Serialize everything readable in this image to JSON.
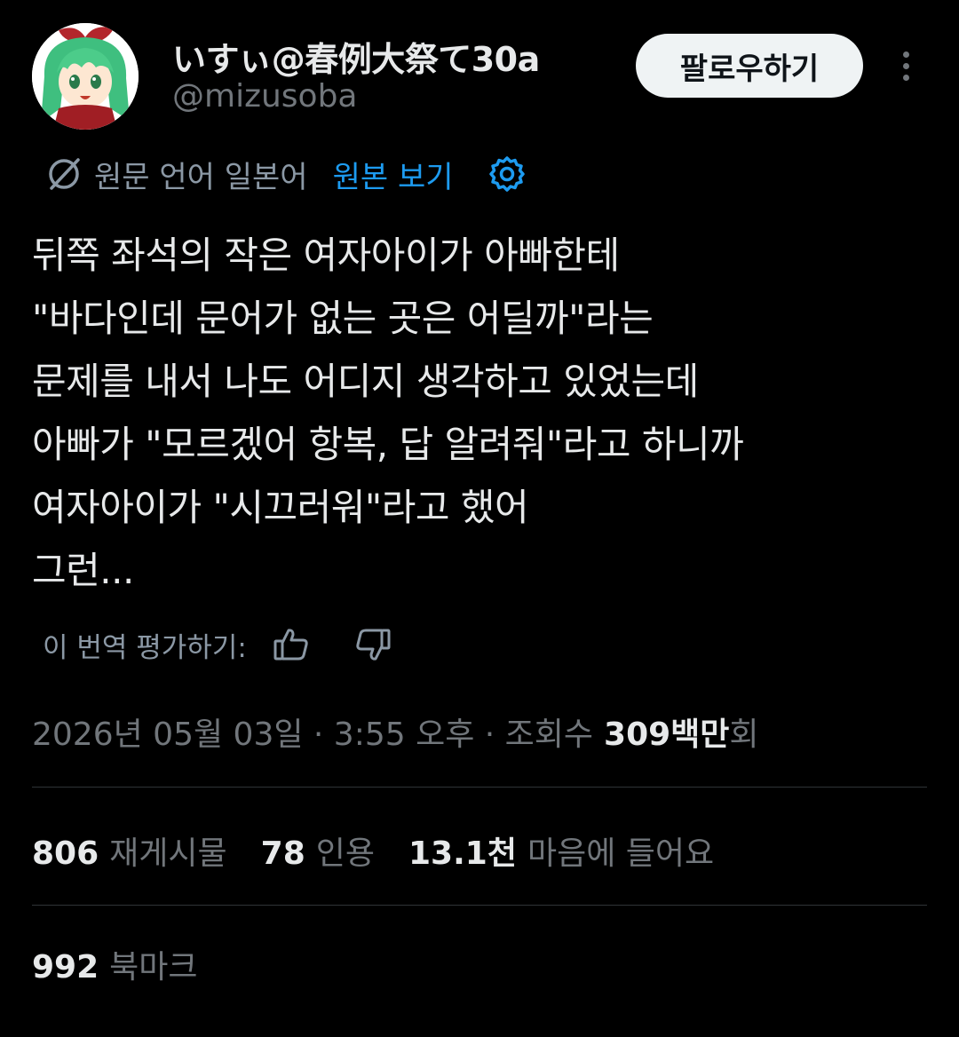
{
  "author": {
    "display_name": "いすぃ@春例大祭て30a",
    "handle": "@mizusoba",
    "avatar_icon": "avatar-green-hair-character"
  },
  "header": {
    "follow_label": "팔로우하기",
    "more_icon": "more-vertical-icon"
  },
  "translation": {
    "icon": "translate-icon",
    "source_language_label": "원문 언어 일본어",
    "view_original_label": "원본 보기",
    "settings_icon": "gear-icon"
  },
  "tweet": {
    "lines": [
      "뒤쪽 좌석의 작은 여자아이가 아빠한테",
      "\"바다인데 문어가 없는 곳은 어딜까\"라는",
      "문제를 내서 나도 어디지 생각하고 있었는데",
      "아빠가 \"모르겠어 항복, 답 알려줘\"라고 하니까",
      "여자아이가 \"시끄러워\"라고 했어",
      "그런..."
    ]
  },
  "rating": {
    "label": "이 번역 평가하기:",
    "thumbs_up_icon": "thumbs-up-icon",
    "thumbs_down_icon": "thumbs-down-icon"
  },
  "meta": {
    "datetime": "2026년 05월 03일 · 3:55 오후 · 조회수",
    "views_number": "309백만",
    "views_suffix": "회"
  },
  "stats": {
    "reposts_count": "806",
    "reposts_label": "재게시물",
    "quotes_count": "78",
    "quotes_label": "인용",
    "likes_count": "13.1천",
    "likes_label": "마음에 들어요",
    "bookmarks_count": "992",
    "bookmarks_label": "북마크"
  },
  "colors": {
    "background": "#000000",
    "text_primary": "#e7e9ea",
    "text_secondary": "#71767b",
    "accent_link": "#1d9bf0",
    "divider": "#2f3336",
    "follow_button_bg": "#eff3f4"
  }
}
